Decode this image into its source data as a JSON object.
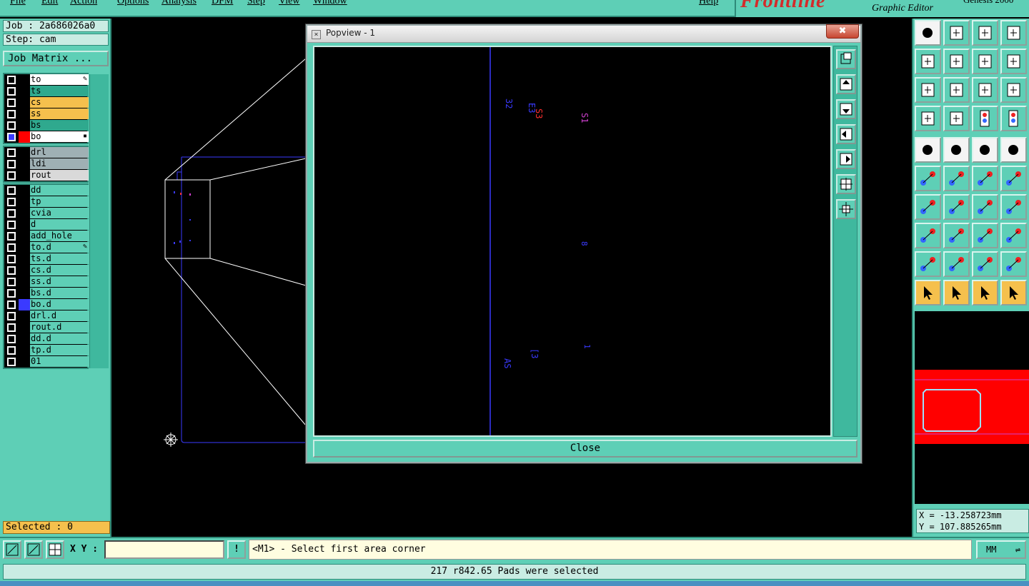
{
  "menu": {
    "items": [
      "File",
      "Edit",
      "Action",
      "Options",
      "Analysis",
      "DFM",
      "Step",
      "View",
      "Window"
    ],
    "help": "Help"
  },
  "brand": {
    "logo": "Frontline",
    "subtitle": "Graphic Editor",
    "right": "Genesis 2000"
  },
  "job": {
    "job_label": "Job : 2a686026a0",
    "step_label": "Step: cam",
    "matrix_button": "Job Matrix ..."
  },
  "layers": {
    "group1": [
      {
        "name": "to",
        "color": "#ffffff",
        "mark": "✎"
      },
      {
        "name": "ts",
        "color": "#2fa98e",
        "mark": ""
      },
      {
        "name": "cs",
        "color": "#f5c04d",
        "mark": ""
      },
      {
        "name": "ss",
        "color": "#f5c04d",
        "mark": ""
      },
      {
        "name": "bs",
        "color": "#2fa98e",
        "mark": ""
      },
      {
        "name": "bo",
        "color": "#ffffff",
        "mark": "▪",
        "work": true
      }
    ],
    "group2": [
      {
        "name": "drl",
        "color": "#9fb0b4"
      },
      {
        "name": "ldi",
        "color": "#9fb0b4"
      },
      {
        "name": "rout",
        "color": "#d9d9d9"
      }
    ],
    "group3": [
      {
        "name": "dd",
        "mark": ""
      },
      {
        "name": "tp",
        "mark": ""
      },
      {
        "name": "cvia",
        "mark": ""
      },
      {
        "name": "d",
        "mark": ""
      },
      {
        "name": "add_hole",
        "mark": ""
      },
      {
        "name": "to.d",
        "mark": "✎"
      },
      {
        "name": "ts.d",
        "mark": ""
      },
      {
        "name": "cs.d",
        "mark": ""
      },
      {
        "name": "ss.d",
        "mark": ""
      },
      {
        "name": "bs.d",
        "mark": ""
      },
      {
        "name": "bo.d",
        "mark": "",
        "affected": true
      },
      {
        "name": "drl.d",
        "mark": ""
      },
      {
        "name": "rout.d",
        "mark": ""
      },
      {
        "name": "dd.d",
        "mark": ""
      },
      {
        "name": "tp.d",
        "mark": ""
      },
      {
        "name": "01",
        "mark": ""
      }
    ]
  },
  "selected_label": "Selected : 0",
  "popview": {
    "title": "Popview - 1",
    "close_button": "Close",
    "close_x": "✖",
    "labels": [
      {
        "text": "32",
        "color": "#3a3aff"
      },
      {
        "text": "E3",
        "color": "#3a3aff"
      },
      {
        "text": "S3",
        "color": "#ff3030"
      },
      {
        "text": "S1",
        "color": "#d040d0"
      },
      {
        "text": "8",
        "color": "#3a3aff"
      },
      {
        "text": "[3",
        "color": "#3a3aff"
      },
      {
        "text": "1",
        "color": "#3a3aff"
      },
      {
        "text": "AS",
        "color": "#3a3aff"
      }
    ]
  },
  "coords": {
    "x": "X = -13.258723mm",
    "y": "Y = 107.885265mm"
  },
  "command": {
    "xy_label": "X Y :",
    "xy_value": "",
    "exclaim": "!",
    "prompt": "<M1> - Select first area corner",
    "units": "MM",
    "units_arrow": "⇌"
  },
  "status": "217 r842.65 Pads were selected",
  "colors": {
    "panel": "#5ecfb6",
    "board_outline": "#3a3aff",
    "mini_board": "#ff0000"
  }
}
